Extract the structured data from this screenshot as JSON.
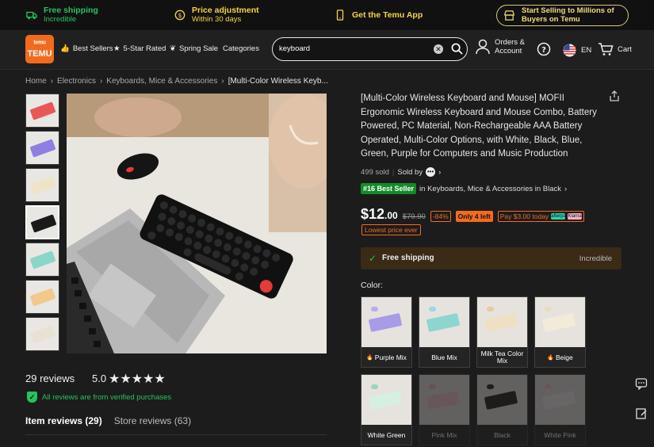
{
  "promo": {
    "shipping_title": "Free shipping",
    "shipping_sub": "Incredible",
    "price_title": "Price adjustment",
    "price_sub": "Within 30 days",
    "app_label": "Get the Temu App",
    "sell_line1": "Start Selling to Millions of",
    "sell_line2": "Buyers on Temu"
  },
  "header": {
    "logo_line1": "ᵗᵉᵐᵘ",
    "logo_line2": "TEMU",
    "nav": [
      "Best Sellers",
      "5-Star Rated",
      "Spring Sale",
      "Categories"
    ],
    "search_value": "keyboard",
    "orders_line1": "Orders &",
    "orders_line2": "Account",
    "lang": "EN",
    "cart": "Cart"
  },
  "breadcrumb": [
    "Home",
    "Electronics",
    "Keyboards, Mice & Accessories",
    "[Multi-Color Wireless Keyb..."
  ],
  "thumbs": [
    {
      "color": "#e85858"
    },
    {
      "color": "#8f7fe0"
    },
    {
      "color": "#efe3c8"
    },
    {
      "color": "#1a1a1a"
    },
    {
      "color": "#8ad6c8"
    },
    {
      "color": "#f1c98a"
    },
    {
      "color": "#e8e2d4"
    }
  ],
  "reviews": {
    "count": "29 reviews",
    "score": "5.0",
    "stars": "★★★★★",
    "verified": "All reviews are from verified purchases",
    "tab_item": "Item reviews (29)",
    "tab_store": "Store reviews (63)"
  },
  "product": {
    "title": "[Multi-Color Wireless Keyboard and Mouse] MOFII Ergonomic Wireless Keyboard and Mouse Combo, Battery Powered, PC Material, Non-Rechargeable AAA Battery Operated, Multi-Color Options, with White, Black, Blue, Green, Purple for Computers and Music Production",
    "sold": "499 sold",
    "sold_by": "Sold by",
    "best_badge": "#16 Best Seller",
    "best_text": "in Keyboards, Mice & Accessories in Black",
    "price_main": "$12",
    "price_cents": ".00",
    "price_orig": "$79.90",
    "discount": "-84%",
    "stock": "Only 4 left",
    "pay": "Pay $3.00 today",
    "pay_b1": "afterpay",
    "pay_b2": "Klarna",
    "lowest": "Lowest price ever"
  },
  "shipping": {
    "label": "Free shipping",
    "right": "Incredible"
  },
  "color_label": "Color:",
  "colors": [
    {
      "name": "Purple Mix",
      "kb": "#a89be8",
      "ms": "#b8acef",
      "hot": true,
      "disabled": false
    },
    {
      "name": "Blue Mix",
      "kb": "#8fd5cf",
      "ms": "#9ad7e8",
      "hot": false,
      "disabled": false
    },
    {
      "name": "Milk Tea Color Mix",
      "kb": "#efe0c4",
      "ms": "#e9c9a1",
      "hot": false,
      "disabled": false
    },
    {
      "name": "Beige",
      "kb": "#f3ead8",
      "ms": "#e9dcc0",
      "hot": true,
      "disabled": false
    },
    {
      "name": "White Green",
      "kb": "#d7efdf",
      "ms": "#9fd5b3",
      "hot": false,
      "disabled": false
    },
    {
      "name": "Pink Mix",
      "kb": "#f2c5cf",
      "ms": "#f2b3c0",
      "hot": false,
      "disabled": true
    },
    {
      "name": "Black",
      "kb": "#1d1d1d",
      "ms": "#222",
      "hot": false,
      "disabled": true
    },
    {
      "name": "White Pink",
      "kb": "#f5eef0",
      "ms": "#f3c3cf",
      "hot": false,
      "disabled": true
    }
  ],
  "accent": "#f26b1d"
}
